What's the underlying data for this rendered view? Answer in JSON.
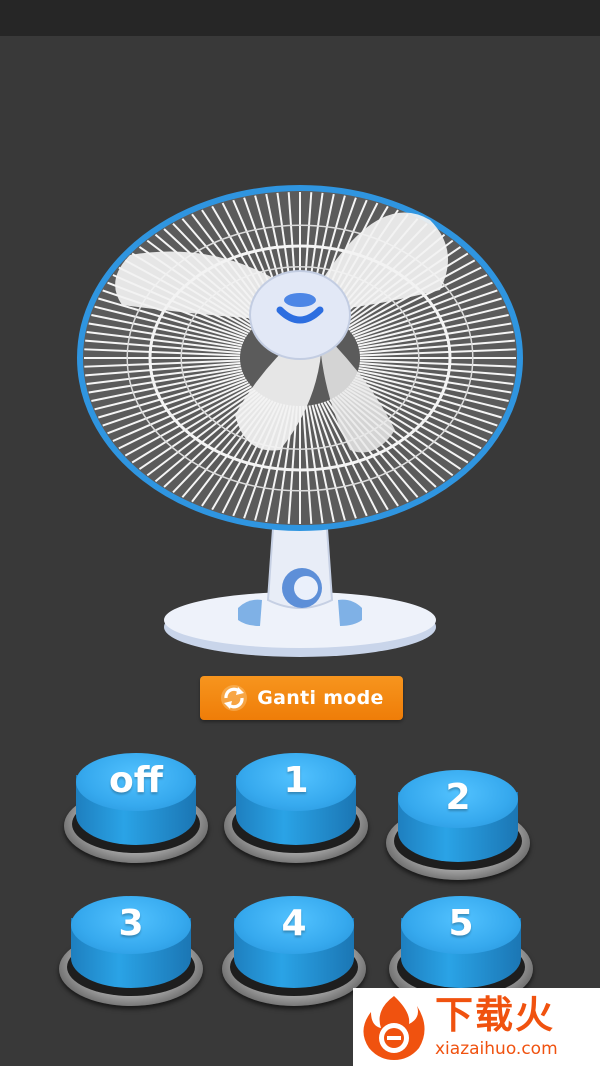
{
  "mode_button": {
    "label": "Ganti mode",
    "icon": "refresh-icon"
  },
  "speed_buttons": [
    {
      "label": "off"
    },
    {
      "label": "1"
    },
    {
      "label": "2"
    },
    {
      "label": "3"
    },
    {
      "label": "4"
    },
    {
      "label": "5"
    }
  ],
  "watermark": {
    "title": "下载火",
    "domain": "xiazaihuo.com"
  },
  "colors": {
    "background": "#393939",
    "status_bar": "#262626",
    "fan_ring": "#2f95e0",
    "button_blue": "#36a9ee",
    "mode_orange": "#f28a12",
    "watermark_orange": "#f0520f"
  }
}
